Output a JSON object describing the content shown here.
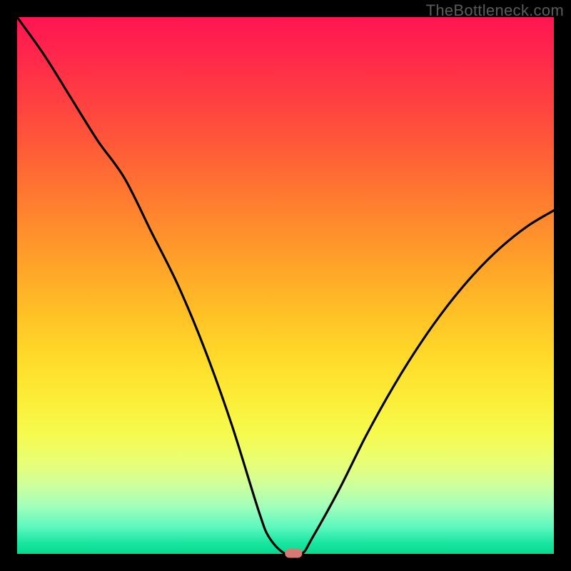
{
  "watermark": "TheBottleneck.com",
  "colors": {
    "background": "#000000",
    "curve": "#000000",
    "marker": "#d77a74",
    "gradient_top": "#ff1551",
    "gradient_bottom": "#08d98f"
  },
  "chart_data": {
    "type": "line",
    "title": "",
    "xlabel": "",
    "ylabel": "",
    "xlim": [
      0,
      100
    ],
    "ylim": [
      0,
      100
    ],
    "x": [
      0,
      5,
      10,
      15,
      20,
      25,
      30,
      35,
      40,
      45,
      47,
      50,
      53,
      55,
      60,
      65,
      70,
      75,
      80,
      85,
      90,
      95,
      100
    ],
    "values": [
      100,
      93,
      85,
      77,
      70,
      60,
      50,
      38,
      24,
      8,
      3,
      0,
      0,
      3,
      12,
      22,
      31,
      39,
      46,
      52,
      57,
      61,
      64
    ],
    "marker": {
      "x": 51.5,
      "y": 0
    },
    "notes": "V-shaped bottleneck curve; minimum (0%) at roughly x≈50–53; left branch reaches 100% at x=0, right branch levels near ~64% at x=100. Values estimated from pixels."
  }
}
